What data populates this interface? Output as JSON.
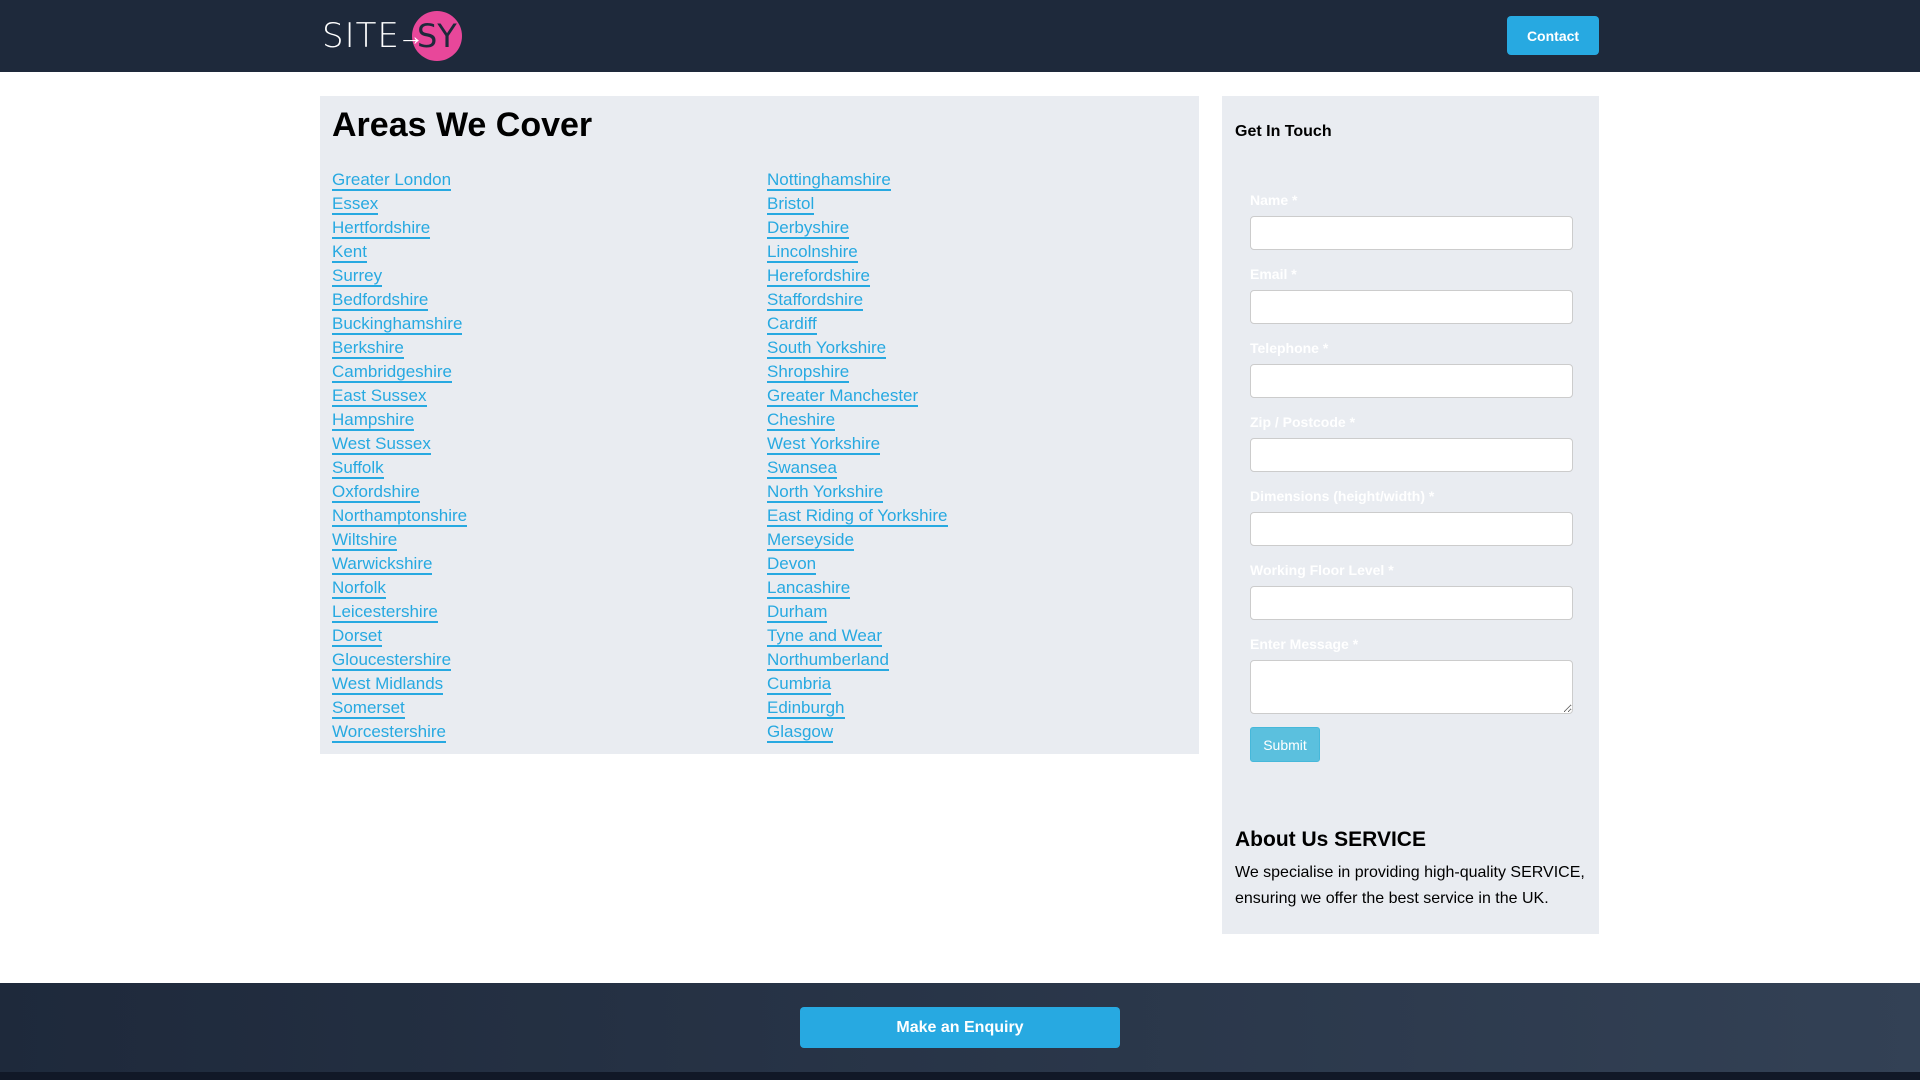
{
  "header": {
    "logo_text": "SITE",
    "logo_accent": "SY",
    "contact_label": "Contact"
  },
  "main": {
    "title": "Areas We Cover",
    "column1": [
      "Greater London",
      "Essex",
      "Hertfordshire",
      "Kent",
      "Surrey",
      "Bedfordshire",
      "Buckinghamshire",
      "Berkshire",
      "Cambridgeshire",
      "East Sussex",
      "Hampshire",
      "West Sussex",
      "Suffolk",
      "Oxfordshire",
      "Northamptonshire",
      "Wiltshire",
      "Warwickshire",
      "Norfolk",
      "Leicestershire",
      "Dorset",
      "Gloucestershire",
      "West Midlands",
      "Somerset",
      "Worcestershire"
    ],
    "column2": [
      "Nottinghamshire",
      "Bristol",
      "Derbyshire",
      "Lincolnshire",
      "Herefordshire",
      "Staffordshire",
      "Cardiff",
      "South Yorkshire",
      "Shropshire",
      "Greater Manchester",
      "Cheshire",
      "West Yorkshire",
      "Swansea",
      "North Yorkshire",
      "East Riding of Yorkshire",
      "Merseyside",
      "Devon",
      "Lancashire",
      "Durham",
      "Tyne and Wear",
      "Northumberland",
      "Cumbria",
      "Edinburgh",
      "Glasgow"
    ]
  },
  "sidebar": {
    "title": "Get In Touch",
    "fields": [
      "Name *",
      "Email *",
      "Telephone *",
      "Zip / Postcode *",
      "Dimensions (height/width) *",
      "Working Floor Level *",
      "Enter Message *"
    ],
    "submit_label": "Submit",
    "about_title": "About Us SERVICE",
    "about_text": "We specialise in providing high-quality SERVICE, ensuring we offer the best service in the UK."
  },
  "footer": {
    "enquiry_label": "Make an Enquiry"
  },
  "colors": {
    "accent": "#27a9e1",
    "header": "#1e293b",
    "logo_pink": "#e8479a"
  }
}
